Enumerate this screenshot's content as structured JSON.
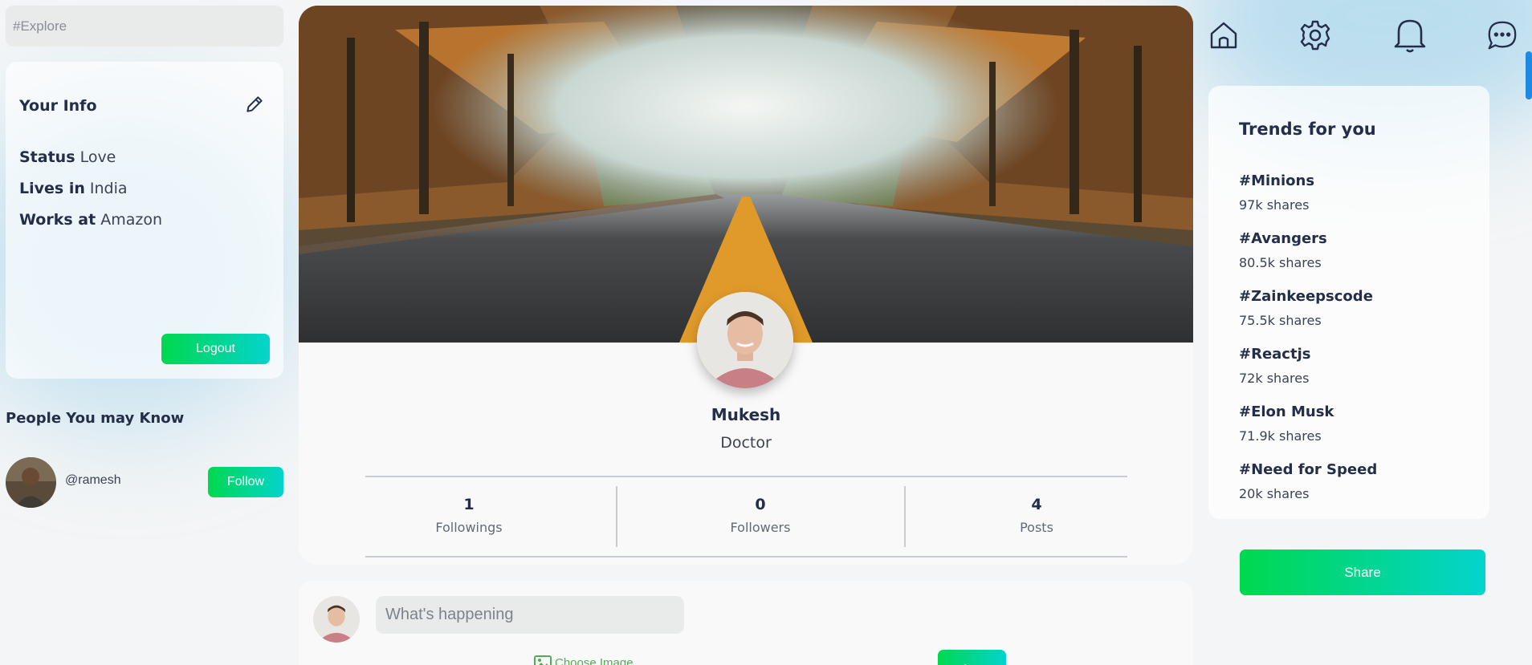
{
  "search": {
    "placeholder": "#Explore"
  },
  "info": {
    "title": "Your Info",
    "rows": [
      {
        "label": "Status",
        "value": "Love"
      },
      {
        "label": "Lives in",
        "value": "India"
      },
      {
        "label": "Works at",
        "value": "Amazon"
      }
    ],
    "logout_label": "Logout"
  },
  "people": {
    "title": "People You may Know",
    "items": [
      {
        "handle": "@ramesh",
        "follow_label": "Follow"
      }
    ]
  },
  "profile": {
    "name": "Mukesh",
    "role": "Doctor",
    "stats": [
      {
        "value": "1",
        "label": "Followings"
      },
      {
        "value": "0",
        "label": "Followers"
      },
      {
        "value": "4",
        "label": "Posts"
      }
    ]
  },
  "post": {
    "placeholder": "What's happening",
    "choose_image_label": "Choose Image",
    "share_label": "Share"
  },
  "nav": {
    "icons": [
      "home-icon",
      "settings-icon",
      "notification-bell-icon",
      "chat-icon"
    ]
  },
  "trends": {
    "title": "Trends for you",
    "items": [
      {
        "tag": "#Minions",
        "shares": "97k shares"
      },
      {
        "tag": "#Avangers",
        "shares": "80.5k shares"
      },
      {
        "tag": "#Zainkeepscode",
        "shares": "75.5k shares"
      },
      {
        "tag": "#Reactjs",
        "shares": "72k shares"
      },
      {
        "tag": "#Elon Musk",
        "shares": "71.9k shares"
      },
      {
        "tag": "#Need for Speed",
        "shares": "20k shares"
      }
    ]
  },
  "share_button_label": "Share",
  "colors": {
    "accent_start": "#00d84f",
    "accent_end": "#04d4cd",
    "text": "#242d49"
  }
}
